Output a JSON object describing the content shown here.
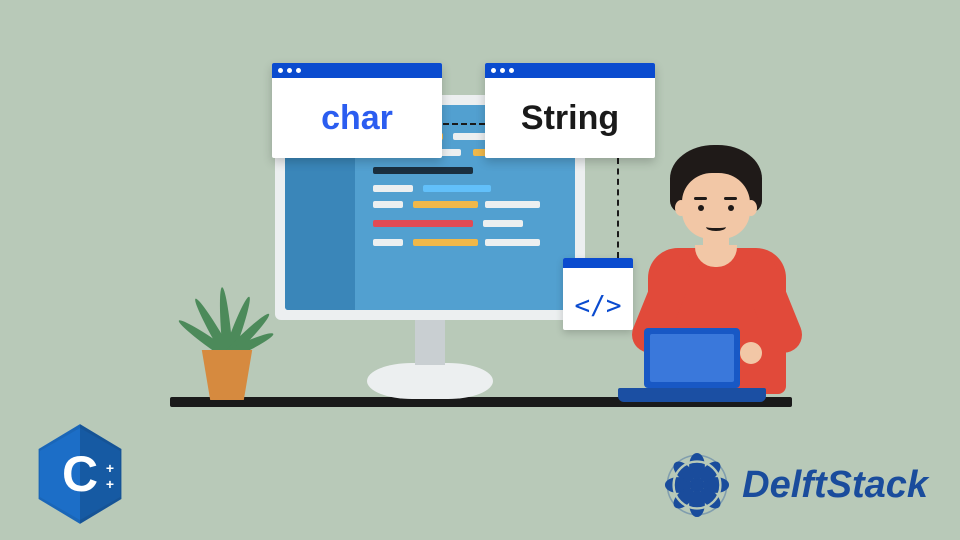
{
  "cards": {
    "char_label": "char",
    "string_label": "String"
  },
  "codeicon": {
    "symbol": "</>"
  },
  "logo_cpp": {
    "letter": "C",
    "plus1": "+",
    "plus2": "+"
  },
  "brand": {
    "name": "DelftStack"
  },
  "colors": {
    "bg": "#b8c9b8",
    "accent_blue": "#0a4bcf",
    "cpp_blue": "#1a66b8",
    "shirt_red": "#e14a3a",
    "brand_blue": "#1a4c9c"
  }
}
